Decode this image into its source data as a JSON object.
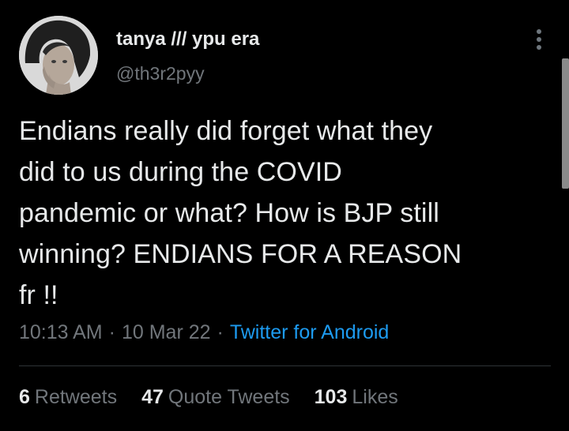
{
  "user": {
    "display_name": "tanya /// ypu era",
    "handle": "@th3r2pyy"
  },
  "tweet": {
    "text": "Endians really did forget what they\ndid to us during the COVID\npandemic or what? How is BJP still\nwinning? ENDIANS FOR A REASON\nfr !!",
    "time": "10:13 AM",
    "separator": "·",
    "date": "10 Mar 22",
    "source": "Twitter for Android"
  },
  "stats": {
    "retweets_count": "6",
    "retweets_label": "Retweets",
    "quotes_count": "47",
    "quotes_label": "Quote Tweets",
    "likes_count": "103",
    "likes_label": "Likes"
  },
  "colors": {
    "background": "#000000",
    "text": "#e7e9ea",
    "secondary": "#71767b",
    "accent": "#1d9bf0",
    "divider": "#2f3336"
  },
  "icons": {
    "more": "more-vertical-icon"
  }
}
